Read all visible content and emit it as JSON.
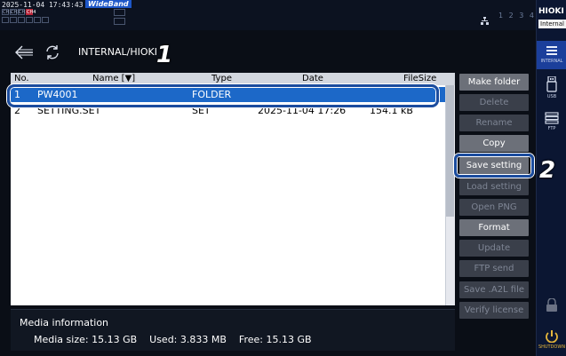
{
  "status": {
    "clock": "2025-11-04 17:43:43",
    "mode_badge": "WideBand",
    "channels": [
      "CH1",
      "CH2",
      "CH3",
      "CH4"
    ],
    "slots": "1 2 3 4"
  },
  "sidebar": {
    "brand": "HIOKI",
    "brand_sub": "Internal",
    "items": [
      {
        "label": "INTERNAL",
        "icon": "internal-storage-icon"
      },
      {
        "label": "USB",
        "icon": "usb-icon"
      },
      {
        "label": "FTP",
        "icon": "ftp-icon"
      },
      {
        "label": "",
        "icon": "lock-icon"
      },
      {
        "label": "SHUTDOWN",
        "icon": "shutdown-icon"
      }
    ]
  },
  "path": {
    "current": "INTERNAL/HIOKI",
    "annotation_1": "1",
    "annotation_2": "2"
  },
  "file_list": {
    "headers": {
      "no": "No.",
      "name": "Name [▼]",
      "type": "Type",
      "date": "Date",
      "size": "FileSize"
    },
    "rows": [
      {
        "no": "1",
        "name": "PW4001",
        "type": "FOLDER",
        "date": "",
        "size": "",
        "selected": true
      },
      {
        "no": "2",
        "name": "SETTING.SET",
        "type": "SET",
        "date": "2025-11-04 17:26",
        "size": "154.1 kB",
        "selected": false
      }
    ]
  },
  "buttons": [
    {
      "label": "Make folder",
      "enabled": true
    },
    {
      "label": "Delete",
      "enabled": false
    },
    {
      "label": "Rename",
      "enabled": false
    },
    {
      "label": "Copy",
      "enabled": true
    },
    {
      "label": "Save setting",
      "enabled": true
    },
    {
      "label": "Load setting",
      "enabled": false
    },
    {
      "label": "Open PNG",
      "enabled": false
    },
    {
      "label": "Format",
      "enabled": true
    },
    {
      "label": "Update",
      "enabled": false
    },
    {
      "label": "FTP send",
      "enabled": false
    },
    {
      "label": "Save .A2L file",
      "enabled": false
    },
    {
      "label": "Verify license",
      "enabled": false
    }
  ],
  "media": {
    "title": "Media information",
    "size_label": "Media size:",
    "size_value": "15.13 GB",
    "used_label": "Used:",
    "used_value": "3.833 MB",
    "free_label": "Free:",
    "free_value": "15.13 GB"
  },
  "colors": {
    "accent": "#1c68c8",
    "highlight": "#1b4c9e",
    "sidebar": "#0b1632"
  }
}
